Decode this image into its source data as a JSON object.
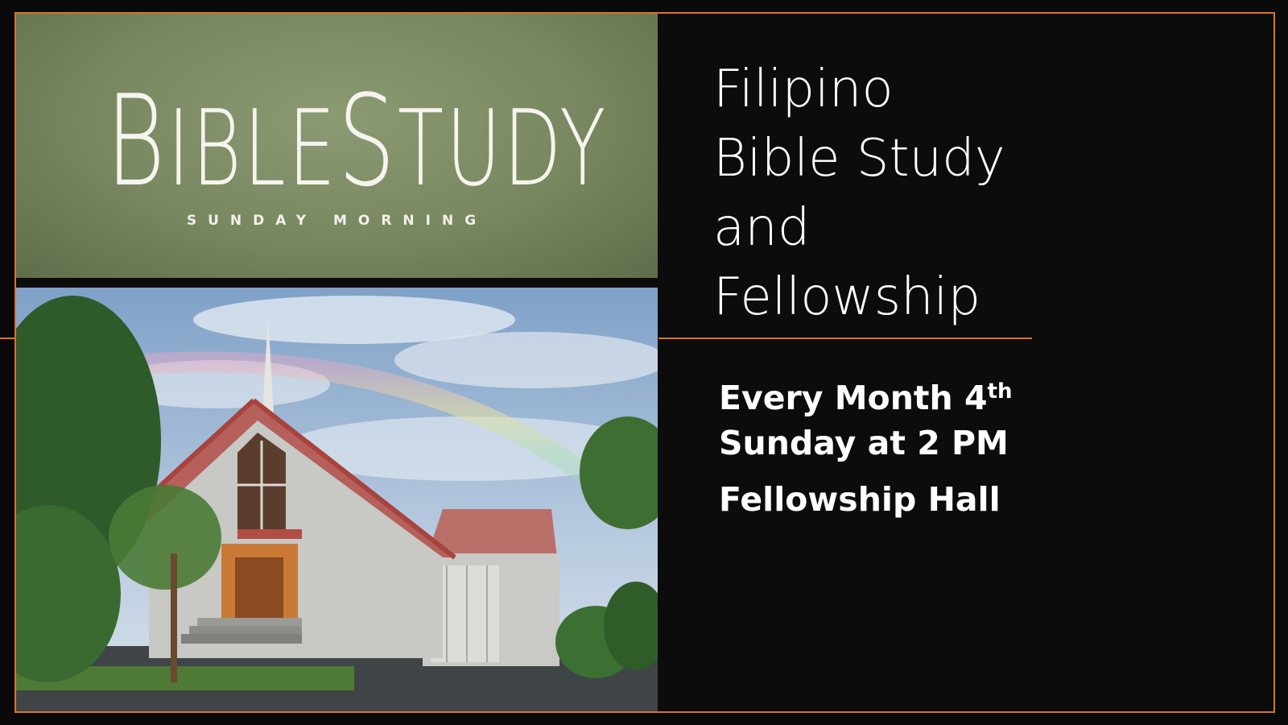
{
  "banner": {
    "title_parts": [
      "B",
      "IBLE",
      "S",
      "TUDY"
    ],
    "subtitle": "SUNDAY MORNING"
  },
  "heading": {
    "lines": [
      "Filipino",
      "Bible Study",
      "and",
      "Fellowship"
    ]
  },
  "schedule": {
    "line1": "Every Month 4",
    "line1_sup": "th",
    "line2": "Sunday at 2 PM",
    "location": "Fellowship Hall"
  },
  "colors": {
    "accent": "#d9742b",
    "banner_green": "#78875f",
    "background": "#0d0c0c",
    "text": "#ffffff"
  }
}
